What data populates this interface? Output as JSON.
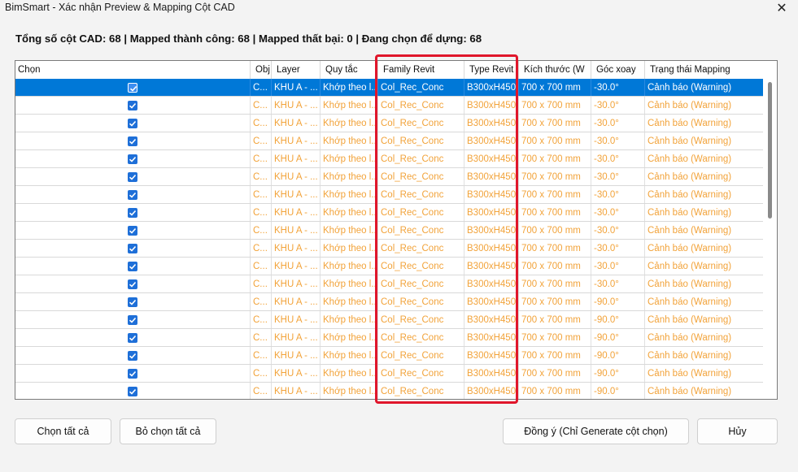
{
  "window": {
    "title": "BimSmart - Xác nhận Preview & Mapping Cột CAD",
    "close_glyph": "✕"
  },
  "summary": "Tổng số cột CAD: 68 | Mapped thành công: 68 | Mapped thất bại: 0 | Đang chọn để dựng: 68",
  "columns": {
    "chon": "Chọn",
    "obj": "Obj",
    "layer": "Layer",
    "quytac": "Quy tắc",
    "family": "Family Revit",
    "type": "Type Revit",
    "kichthuoc": "Kích thước (W",
    "gocxoay": "Góc xoay",
    "trangthai": "Trạng thái Mapping"
  },
  "rows": [
    {
      "selected": true,
      "checked": true,
      "obj": "C...",
      "layer": "KHU A - ...",
      "quytac": "Khớp theo l...",
      "family": "Col_Rec_Conc",
      "type": "B300xH450",
      "size": "700 x 700 mm",
      "angle": "-30.0°",
      "status": "Cảnh báo (Warning)"
    },
    {
      "selected": false,
      "checked": true,
      "obj": "C...",
      "layer": "KHU A - ...",
      "quytac": "Khớp theo l...",
      "family": "Col_Rec_Conc",
      "type": "B300xH450",
      "size": "700 x 700 mm",
      "angle": "-30.0°",
      "status": "Cảnh báo (Warning)"
    },
    {
      "selected": false,
      "checked": true,
      "obj": "C...",
      "layer": "KHU A - ...",
      "quytac": "Khớp theo l...",
      "family": "Col_Rec_Conc",
      "type": "B300xH450",
      "size": "700 x 700 mm",
      "angle": "-30.0°",
      "status": "Cảnh báo (Warning)"
    },
    {
      "selected": false,
      "checked": true,
      "obj": "C...",
      "layer": "KHU A - ...",
      "quytac": "Khớp theo l...",
      "family": "Col_Rec_Conc",
      "type": "B300xH450",
      "size": "700 x 700 mm",
      "angle": "-30.0°",
      "status": "Cảnh báo (Warning)"
    },
    {
      "selected": false,
      "checked": true,
      "obj": "C...",
      "layer": "KHU A - ...",
      "quytac": "Khớp theo l...",
      "family": "Col_Rec_Conc",
      "type": "B300xH450",
      "size": "700 x 700 mm",
      "angle": "-30.0°",
      "status": "Cảnh báo (Warning)"
    },
    {
      "selected": false,
      "checked": true,
      "obj": "C...",
      "layer": "KHU A - ...",
      "quytac": "Khớp theo l...",
      "family": "Col_Rec_Conc",
      "type": "B300xH450",
      "size": "700 x 700 mm",
      "angle": "-30.0°",
      "status": "Cảnh báo (Warning)"
    },
    {
      "selected": false,
      "checked": true,
      "obj": "C...",
      "layer": "KHU A - ...",
      "quytac": "Khớp theo l...",
      "family": "Col_Rec_Conc",
      "type": "B300xH450",
      "size": "700 x 700 mm",
      "angle": "-30.0°",
      "status": "Cảnh báo (Warning)"
    },
    {
      "selected": false,
      "checked": true,
      "obj": "C...",
      "layer": "KHU A - ...",
      "quytac": "Khớp theo l...",
      "family": "Col_Rec_Conc",
      "type": "B300xH450",
      "size": "700 x 700 mm",
      "angle": "-30.0°",
      "status": "Cảnh báo (Warning)"
    },
    {
      "selected": false,
      "checked": true,
      "obj": "C...",
      "layer": "KHU A - ...",
      "quytac": "Khớp theo l...",
      "family": "Col_Rec_Conc",
      "type": "B300xH450",
      "size": "700 x 700 mm",
      "angle": "-30.0°",
      "status": "Cảnh báo (Warning)"
    },
    {
      "selected": false,
      "checked": true,
      "obj": "C...",
      "layer": "KHU A - ...",
      "quytac": "Khớp theo l...",
      "family": "Col_Rec_Conc",
      "type": "B300xH450",
      "size": "700 x 700 mm",
      "angle": "-30.0°",
      "status": "Cảnh báo (Warning)"
    },
    {
      "selected": false,
      "checked": true,
      "obj": "C...",
      "layer": "KHU A - ...",
      "quytac": "Khớp theo l...",
      "family": "Col_Rec_Conc",
      "type": "B300xH450",
      "size": "700 x 700 mm",
      "angle": "-30.0°",
      "status": "Cảnh báo (Warning)"
    },
    {
      "selected": false,
      "checked": true,
      "obj": "C...",
      "layer": "KHU A - ...",
      "quytac": "Khớp theo l...",
      "family": "Col_Rec_Conc",
      "type": "B300xH450",
      "size": "700 x 700 mm",
      "angle": "-30.0°",
      "status": "Cảnh báo (Warning)"
    },
    {
      "selected": false,
      "checked": true,
      "obj": "C...",
      "layer": "KHU A - ...",
      "quytac": "Khớp theo l...",
      "family": "Col_Rec_Conc",
      "type": "B300xH450",
      "size": "700 x 700 mm",
      "angle": "-90.0°",
      "status": "Cảnh báo (Warning)"
    },
    {
      "selected": false,
      "checked": true,
      "obj": "C...",
      "layer": "KHU A - ...",
      "quytac": "Khớp theo l...",
      "family": "Col_Rec_Conc",
      "type": "B300xH450",
      "size": "700 x 700 mm",
      "angle": "-90.0°",
      "status": "Cảnh báo (Warning)"
    },
    {
      "selected": false,
      "checked": true,
      "obj": "C...",
      "layer": "KHU A - ...",
      "quytac": "Khớp theo l...",
      "family": "Col_Rec_Conc",
      "type": "B300xH450",
      "size": "700 x 700 mm",
      "angle": "-90.0°",
      "status": "Cảnh báo (Warning)"
    },
    {
      "selected": false,
      "checked": true,
      "obj": "C...",
      "layer": "KHU A - ...",
      "quytac": "Khớp theo l...",
      "family": "Col_Rec_Conc",
      "type": "B300xH450",
      "size": "700 x 700 mm",
      "angle": "-90.0°",
      "status": "Cảnh báo (Warning)"
    },
    {
      "selected": false,
      "checked": true,
      "obj": "C...",
      "layer": "KHU A - ...",
      "quytac": "Khớp theo l...",
      "family": "Col_Rec_Conc",
      "type": "B300xH450",
      "size": "700 x 700 mm",
      "angle": "-90.0°",
      "status": "Cảnh báo (Warning)"
    },
    {
      "selected": false,
      "checked": true,
      "obj": "C...",
      "layer": "KHU A - ...",
      "quytac": "Khớp theo l...",
      "family": "Col_Rec_Conc",
      "type": "B300xH450",
      "size": "700 x 700 mm",
      "angle": "-90.0°",
      "status": "Cảnh báo (Warning)"
    }
  ],
  "buttons": {
    "select_all": "Chọn tất cả",
    "deselect_all": "Bỏ chọn tất cả",
    "confirm": "Đồng ý (Chỉ Generate cột chọn)",
    "cancel": "Hủy"
  },
  "colors": {
    "warning_text": "#f2a33a",
    "selection": "#0078d7",
    "highlight_box": "#e0162b"
  }
}
